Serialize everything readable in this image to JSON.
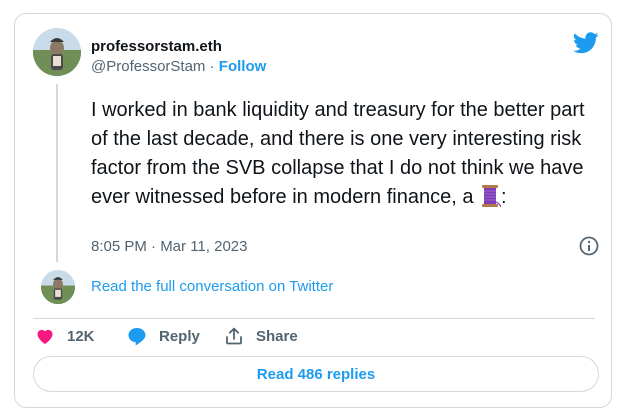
{
  "author": {
    "display_name": "professorstam.eth",
    "handle": "@ProfessorStam",
    "separator": " · ",
    "follow_label": "Follow"
  },
  "tweet": {
    "text": "I worked in bank liquidity and treasury for the better part of the last decade, and there is one very interesting risk factor from the SVB collapse that I do not think we have ever witnessed before in modern finance, a ",
    "emoji": "thread-spool-icon",
    "text_end": ":",
    "timestamp": "8:05 PM · Mar 11, 2023"
  },
  "conversation": {
    "read_full_label": "Read the full conversation on Twitter"
  },
  "actions": {
    "likes_count": "12K",
    "reply_label": "Reply",
    "share_label": "Share"
  },
  "replies": {
    "button_label": "Read 486 replies"
  },
  "colors": {
    "accent": "#1d9bf0",
    "like": "#f91880",
    "secondary_text": "#536471",
    "border": "#cfd9de"
  }
}
